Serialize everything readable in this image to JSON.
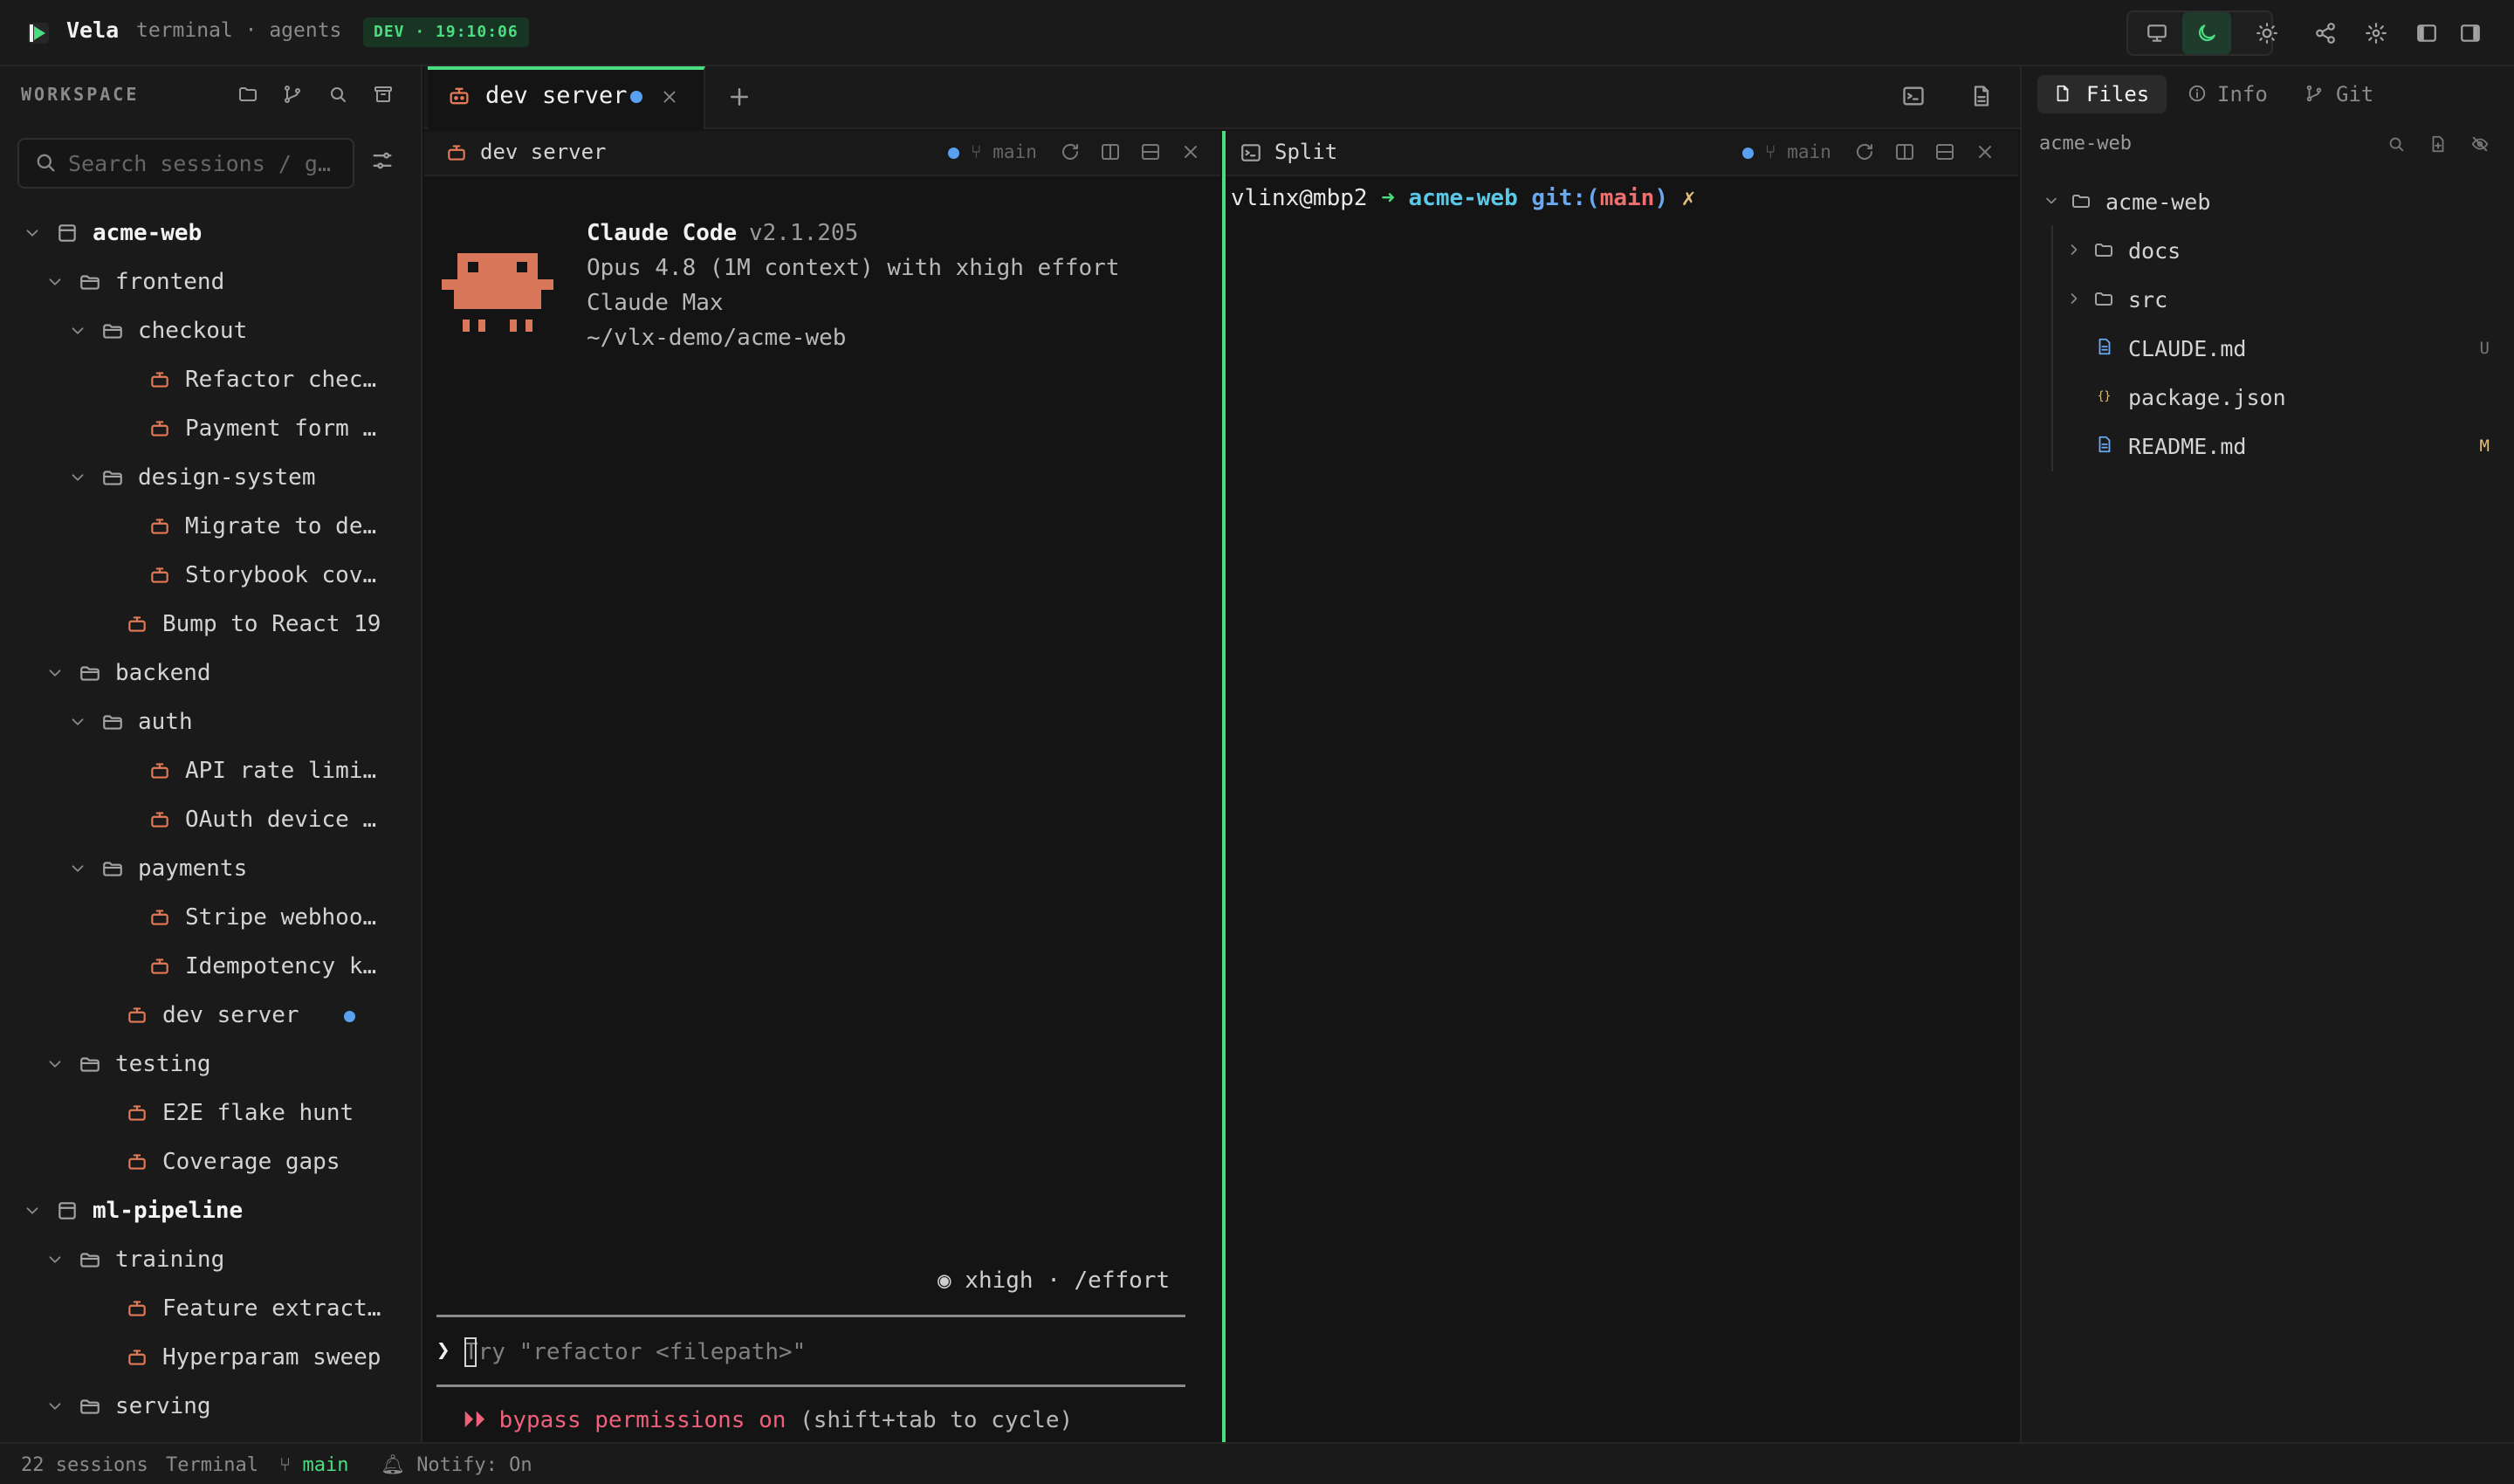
{
  "app": {
    "name": "Vela",
    "subtitle": "terminal · agents",
    "badge": "DEV · 19:10:06"
  },
  "sidebar": {
    "title": "WORKSPACE",
    "search_placeholder": "Search sessions / g…",
    "tree": [
      {
        "label": "acme-web",
        "kind": "project",
        "depth": 0,
        "expanded": true
      },
      {
        "label": "frontend",
        "kind": "folder",
        "depth": 1,
        "expanded": true
      },
      {
        "label": "checkout",
        "kind": "folder",
        "depth": 2,
        "expanded": true
      },
      {
        "label": "Refactor chec…",
        "kind": "session",
        "depth": 3
      },
      {
        "label": "Payment form …",
        "kind": "session",
        "depth": 3
      },
      {
        "label": "design-system",
        "kind": "folder",
        "depth": 2,
        "expanded": true
      },
      {
        "label": "Migrate to de…",
        "kind": "session",
        "depth": 3
      },
      {
        "label": "Storybook cov…",
        "kind": "session",
        "depth": 3
      },
      {
        "label": "Bump to React 19",
        "kind": "session",
        "depth": 2
      },
      {
        "label": "backend",
        "kind": "folder",
        "depth": 1,
        "expanded": true
      },
      {
        "label": "auth",
        "kind": "folder",
        "depth": 2,
        "expanded": true
      },
      {
        "label": "API rate limi…",
        "kind": "session",
        "depth": 3
      },
      {
        "label": "OAuth device …",
        "kind": "session",
        "depth": 3
      },
      {
        "label": "payments",
        "kind": "folder",
        "depth": 2,
        "expanded": true
      },
      {
        "label": "Stripe webhoo…",
        "kind": "session",
        "depth": 3
      },
      {
        "label": "Idempotency k…",
        "kind": "session",
        "depth": 3
      },
      {
        "label": "dev server",
        "kind": "session",
        "depth": 2,
        "active": true
      },
      {
        "label": "testing",
        "kind": "folder",
        "depth": 1,
        "expanded": true
      },
      {
        "label": "E2E flake hunt",
        "kind": "session",
        "depth": 2
      },
      {
        "label": "Coverage gaps",
        "kind": "session",
        "depth": 2
      },
      {
        "label": "ml-pipeline",
        "kind": "project",
        "depth": 0,
        "expanded": true
      },
      {
        "label": "training",
        "kind": "folder",
        "depth": 1,
        "expanded": true
      },
      {
        "label": "Feature extract…",
        "kind": "session",
        "depth": 2
      },
      {
        "label": "Hyperparam sweep",
        "kind": "session",
        "depth": 2
      },
      {
        "label": "serving",
        "kind": "folder",
        "depth": 1,
        "expanded": true
      }
    ]
  },
  "tabs": [
    {
      "label": "dev server",
      "active": true,
      "unread": true
    }
  ],
  "pane_left": {
    "title": "dev server",
    "branch": "main",
    "claude": {
      "name": "Claude Code",
      "version": "v2.1.205",
      "model": "Opus 4.8 (1M context) with xhigh effort",
      "plan": "Claude Max",
      "cwd": "~/vlx-demo/acme-web"
    },
    "effort": "◉ xhigh · /effort",
    "prompt_symbol": "❯",
    "prompt_placeholder": "Try \"refactor <filepath>\"",
    "bypass_arrows": "⏵⏵",
    "bypass_text": "bypass permissions on",
    "bypass_hint": "(shift+tab to cycle)"
  },
  "pane_right": {
    "title": "Split",
    "branch": "main",
    "prompt_user": "vlinx@mbp2",
    "prompt_arrow": "➜",
    "prompt_dir": "acme-web",
    "prompt_git": "git:(",
    "prompt_branch": "main",
    "prompt_git_close": ")",
    "prompt_dirty": "✗"
  },
  "files_panel": {
    "tabs": [
      "Files",
      "Info",
      "Git"
    ],
    "active_tab": "Files",
    "root_label": "acme-web",
    "tree": [
      {
        "label": "acme-web",
        "kind": "folder",
        "expanded": true
      },
      {
        "label": "docs",
        "kind": "folder",
        "expanded": false
      },
      {
        "label": "src",
        "kind": "folder",
        "expanded": false
      },
      {
        "label": "CLAUDE.md",
        "kind": "markdown",
        "status": "U"
      },
      {
        "label": "package.json",
        "kind": "json",
        "status": ""
      },
      {
        "label": "README.md",
        "kind": "markdown",
        "status": "M"
      }
    ]
  },
  "statusbar": {
    "sessions": "22 sessions",
    "mode": "Terminal",
    "branch": "main",
    "notify": "Notify: On"
  },
  "colors": {
    "accent_green": "#4ade80",
    "claude_orange": "#e27a56",
    "unread_blue": "#5aa0f0",
    "bypass_red": "#f0607a",
    "status_modified": "#e5c07b"
  }
}
